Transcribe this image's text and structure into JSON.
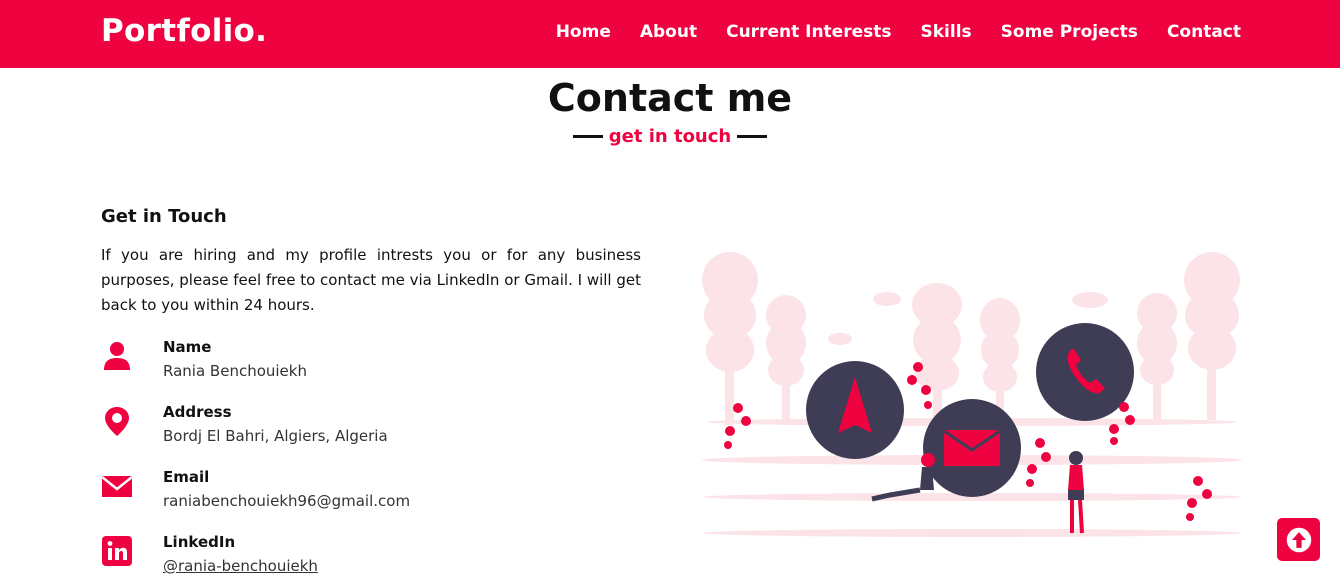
{
  "brand": {
    "name": "Portfolio."
  },
  "nav": {
    "items": [
      {
        "label": "Home"
      },
      {
        "label": "About"
      },
      {
        "label": "Current Interests"
      },
      {
        "label": "Skills"
      },
      {
        "label": "Some Projects"
      },
      {
        "label": "Contact"
      }
    ]
  },
  "section": {
    "title": "Contact me",
    "subtitle": "get in touch"
  },
  "get_in_touch": {
    "heading": "Get in Touch",
    "text": "If you are hiring and my profile intrests you or for any business purposes, please feel free to contact me via LinkedIn or Gmail. I will get back to you within 24 hours."
  },
  "info": {
    "name": {
      "label": "Name",
      "value": "Rania Benchouiekh",
      "icon": "user-icon"
    },
    "address": {
      "label": "Address",
      "value": "Bordj El Bahri, Algiers, Algeria",
      "icon": "map-marker-icon"
    },
    "email": {
      "label": "Email",
      "value": "raniabenchouiekh96@gmail.com",
      "icon": "envelope-icon"
    },
    "linkedin": {
      "label": "LinkedIn",
      "value": "@rania-benchouiekh",
      "icon": "linkedin-icon"
    }
  },
  "colors": {
    "accent": "#ee0240",
    "dark": "#3f3d56",
    "pale": "#fbe3e8"
  },
  "scroll_top": {
    "icon": "arrow-up-icon"
  }
}
